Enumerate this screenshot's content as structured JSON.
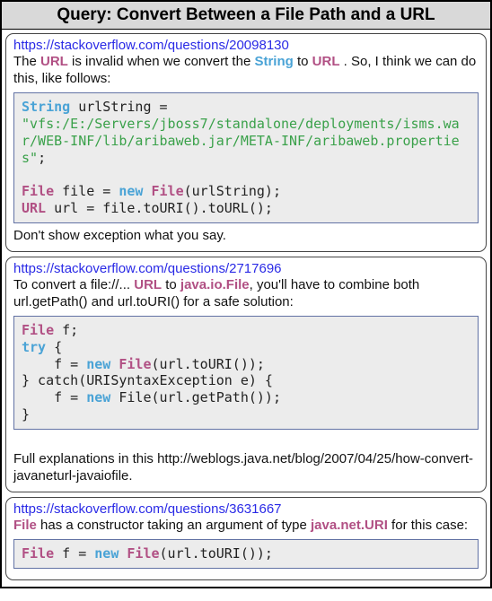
{
  "header": {
    "title": "Query: Convert Between a File Path and a URL"
  },
  "results": [
    {
      "url": "https://stackoverflow.com/questions/20098130",
      "desc_html": "The <span class=\"t-type\">URL</span> is invalid when we convert the <span class=\"t-key\">String</span> to <span class=\"t-type\">URL</span> . So, I think we can do this, like follows:",
      "code_html": "<span class=\"t-key\">String</span> urlString = \n<span class=\"t-str\">\"vfs:/E:/Servers/jboss7/standalone/deployments/isms.war/WEB-INF/lib/aribaweb.jar/META-INF/aribaweb.properties\"</span>;\n\n<span class=\"t-type\">File</span> file = <span class=\"t-key\">new</span> <span class=\"t-type\">File</span>(urlString);\n<span class=\"t-type\">URL</span> url = file.toURI().toURL();",
      "after_html": "Don't show exception what you say."
    },
    {
      "url": "https://stackoverflow.com/questions/2717696",
      "desc_html": "To convert a file://...  <span class=\"t-type\">URL</span> to  <span class=\"t-type\">java.io.File</span>, you'll have to combine both url.getPath() and url.toURI() for a safe solution:",
      "code_html": "<span class=\"t-type\">File</span> f;\n<span class=\"t-key\">try</span> {\n    f = <span class=\"t-key\">new</span> <span class=\"t-type\">File</span>(url.toURI());\n} catch(URISyntaxException e) {\n    f = <span class=\"t-key\">new</span> File(url.getPath());\n}",
      "after_html": "<br>Full explanations in this http://weblogs.java.net/blog/2007/04/25/how-convert-javaneturl-javaiofile."
    },
    {
      "url": "https://stackoverflow.com/questions/3631667",
      "desc_html": "<span class=\"t-type\">File</span> has a constructor taking an argument of type <span class=\"t-type\">java.net.URI</span> for this case:",
      "code_html": "<span class=\"t-type\">File</span> f = <span class=\"t-key\">new</span> <span class=\"t-type\">File</span>(url.toURI());",
      "after_html": ""
    }
  ]
}
